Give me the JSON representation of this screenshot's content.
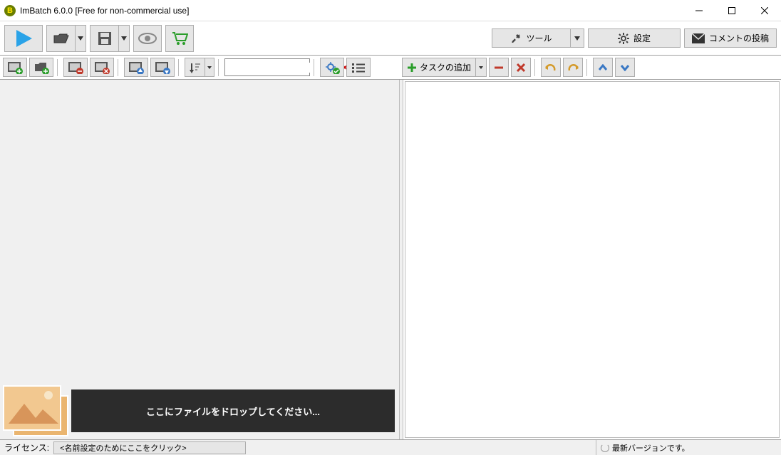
{
  "title": "ImBatch 6.0.0 [Free for non-commercial use]",
  "app_icon_letter": "B",
  "main_toolbar": {
    "tools_label": "ツール",
    "settings_label": "設定",
    "feedback_label": "コメントの投稿"
  },
  "secondary": {
    "search_placeholder": "",
    "addtask_label": "タスクの追加"
  },
  "dropzone": {
    "label": "ここにファイルをドロップしてください..."
  },
  "statusbar": {
    "license_label": "ライセンス:",
    "set_name_label": "<名前設定のためにここをクリック>",
    "update_label": "最新バージョンです。"
  }
}
